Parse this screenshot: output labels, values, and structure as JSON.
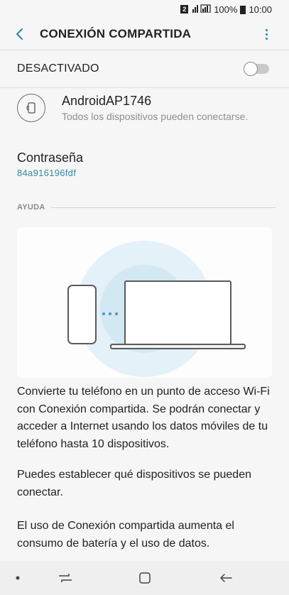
{
  "status_bar": {
    "sim_slot": "2",
    "battery": "100%",
    "time": "10:00"
  },
  "app_bar": {
    "title": "CONEXIÓN COMPARTIDA"
  },
  "toggle": {
    "label": "DESACTIVADO",
    "state": "off"
  },
  "network": {
    "name": "AndroidAP1746",
    "subtitle": "Todos los dispositivos pueden conectarse."
  },
  "password": {
    "label": "Contraseña",
    "value": "84a916196fdf"
  },
  "help": {
    "title": "AYUDA",
    "paragraphs": [
      "Convierte tu teléfono en un punto de acceso Wi-Fi con Conexión compartida. Se podrán conectar y acceder a Internet usando los datos móviles de tu teléfono hasta 10 dispositivos.",
      "Puedes establecer qué dispositivos se pueden conectar.",
      "El uso de Conexión compartida aumenta el consumo de batería y el uso de datos."
    ]
  },
  "colors": {
    "accent": "#2f7fb8",
    "password_value": "#3489a8",
    "illustration_circle_outer": "#e4f1f8",
    "illustration_circle_inner": "#cfe7f3"
  },
  "icons": {
    "back": "chevron-left-icon",
    "more": "more-vertical-icon",
    "network": "hotspot-device-icon",
    "nav_recent": "recent-apps-icon",
    "nav_home": "home-icon",
    "nav_back": "back-arrow-icon"
  }
}
